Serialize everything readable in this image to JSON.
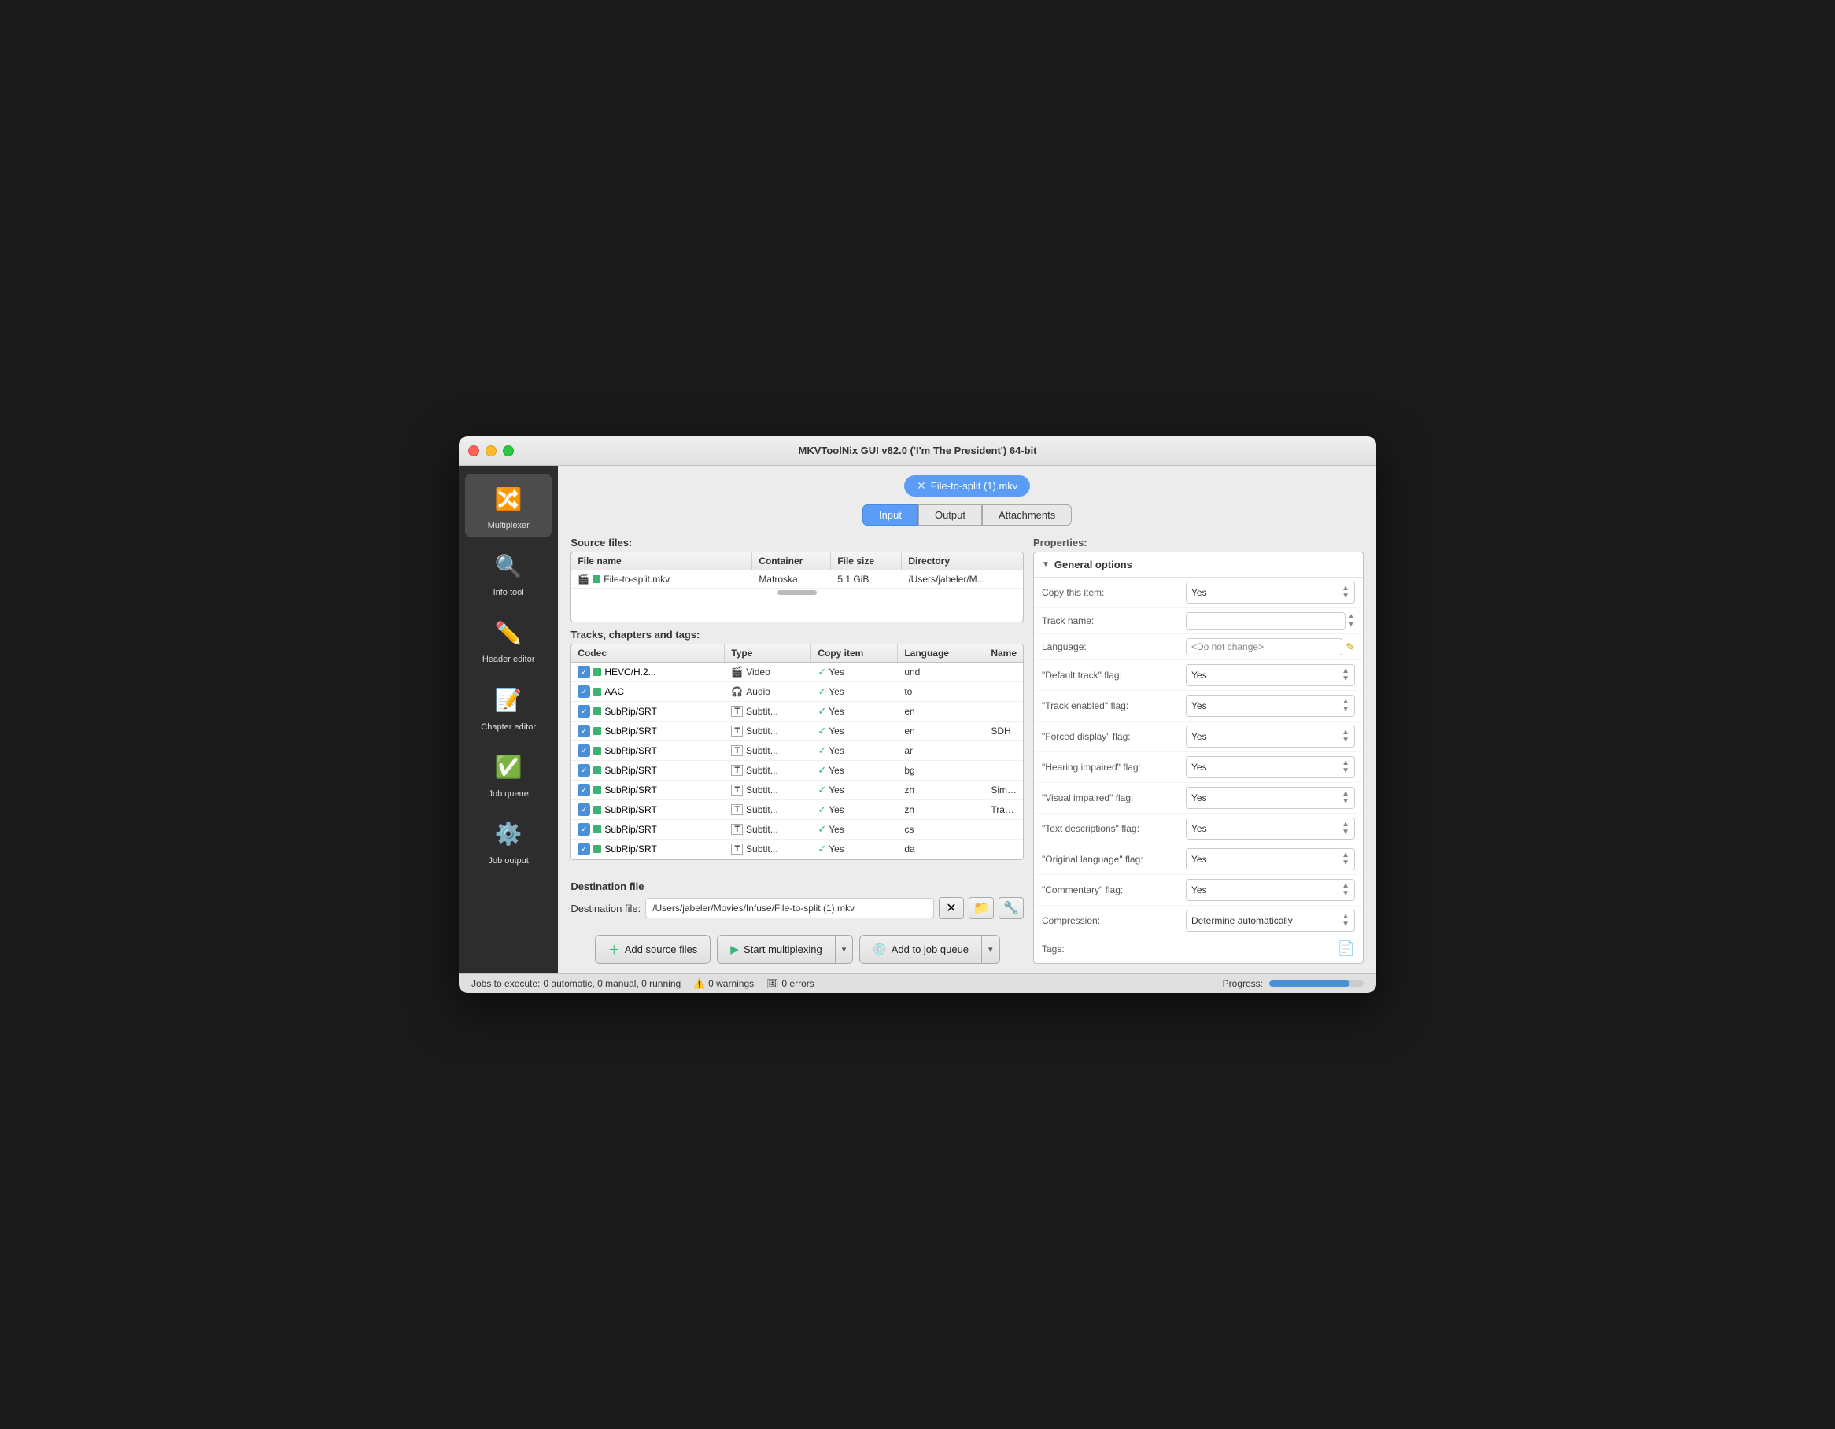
{
  "window": {
    "title": "MKVToolNix GUI v82.0 ('I'm The President') 64-bit"
  },
  "sidebar": {
    "items": [
      {
        "id": "multiplexer",
        "label": "Multiplexer",
        "icon": "🔀",
        "active": true
      },
      {
        "id": "info-tool",
        "label": "Info tool",
        "icon": "🔍"
      },
      {
        "id": "header-editor",
        "label": "Header editor",
        "icon": "✏️"
      },
      {
        "id": "chapter-editor",
        "label": "Chapter editor",
        "icon": "📝"
      },
      {
        "id": "job-queue",
        "label": "Job queue",
        "icon": "✅"
      },
      {
        "id": "job-output",
        "label": "Job output",
        "icon": "⚙️"
      }
    ]
  },
  "file_tab": {
    "name": "File-to-split (1).mkv",
    "close_icon": "✕"
  },
  "nav_tabs": {
    "items": [
      "Input",
      "Output",
      "Attachments"
    ],
    "active": "Input"
  },
  "source_files": {
    "label": "Source files:",
    "columns": [
      "File name",
      "Container",
      "File size",
      "Directory"
    ],
    "rows": [
      {
        "filename": "File-to-split.mkv",
        "container": "Matroska",
        "filesize": "5.1 GiB",
        "directory": "/Users/jabeler/M..."
      }
    ]
  },
  "tracks": {
    "label": "Tracks, chapters and tags:",
    "columns": [
      "Codec",
      "Type",
      "Copy item",
      "Language",
      "Name"
    ],
    "rows": [
      {
        "codec": "HEVC/H.2...",
        "type": "Video",
        "type_icon": "🎬",
        "copy": "Yes",
        "language": "und",
        "name": ""
      },
      {
        "codec": "AAC",
        "type": "Audio",
        "type_icon": "🎧",
        "copy": "Yes",
        "language": "to",
        "name": ""
      },
      {
        "codec": "SubRip/SRT",
        "type": "Subtit...",
        "type_icon": "T",
        "copy": "Yes",
        "language": "en",
        "name": ""
      },
      {
        "codec": "SubRip/SRT",
        "type": "Subtit...",
        "type_icon": "T",
        "copy": "Yes",
        "language": "en",
        "name": "SDH"
      },
      {
        "codec": "SubRip/SRT",
        "type": "Subtit...",
        "type_icon": "T",
        "copy": "Yes",
        "language": "ar",
        "name": ""
      },
      {
        "codec": "SubRip/SRT",
        "type": "Subtit...",
        "type_icon": "T",
        "copy": "Yes",
        "language": "bg",
        "name": ""
      },
      {
        "codec": "SubRip/SRT",
        "type": "Subtit...",
        "type_icon": "T",
        "copy": "Yes",
        "language": "zh",
        "name": "Simplifie"
      },
      {
        "codec": "SubRip/SRT",
        "type": "Subtit...",
        "type_icon": "T",
        "copy": "Yes",
        "language": "zh",
        "name": "Tradition"
      },
      {
        "codec": "SubRip/SRT",
        "type": "Subtit...",
        "type_icon": "T",
        "copy": "Yes",
        "language": "cs",
        "name": ""
      },
      {
        "codec": "SubRip/SRT",
        "type": "Subtit...",
        "type_icon": "T",
        "copy": "Yes",
        "language": "da",
        "name": ""
      }
    ]
  },
  "properties": {
    "label": "Properties:",
    "general_options_title": "General options",
    "rows": [
      {
        "label": "Copy this item:",
        "value": "Yes",
        "type": "select"
      },
      {
        "label": "Track name:",
        "value": "",
        "type": "input"
      },
      {
        "label": "Language:",
        "value": "<Do not change>",
        "type": "language"
      },
      {
        "label": "\"Default track\" flag:",
        "value": "Yes",
        "type": "select"
      },
      {
        "label": "\"Track enabled\" flag:",
        "value": "Yes",
        "type": "select"
      },
      {
        "label": "\"Forced display\" flag:",
        "value": "Yes",
        "type": "select"
      },
      {
        "label": "\"Hearing impaired\" flag:",
        "value": "Yes",
        "type": "select"
      },
      {
        "label": "\"Visual impaired\" flag:",
        "value": "Yes",
        "type": "select"
      },
      {
        "label": "\"Text descriptions\" flag:",
        "value": "Yes",
        "type": "select"
      },
      {
        "label": "\"Original language\" flag:",
        "value": "Yes",
        "type": "select"
      },
      {
        "label": "\"Commentary\" flag:",
        "value": "Yes",
        "type": "select"
      },
      {
        "label": "Compression:",
        "value": "Determine automatically",
        "type": "select"
      },
      {
        "label": "Tags:",
        "value": "",
        "type": "tags"
      }
    ]
  },
  "destination": {
    "section_label": "Destination file",
    "label": "Destination file:",
    "value": "/Users/jabeler/Movies/Infuse/File-to-split (1).mkv"
  },
  "action_buttons": {
    "add_source": "Add source files",
    "start_mux": "Start multiplexing",
    "add_queue": "Add to job queue"
  },
  "statusbar": {
    "jobs_label": "Jobs to execute:",
    "jobs_value": "0 automatic, 0 manual, 0 running",
    "warnings_label": "0 warnings",
    "errors_label": "0 errors",
    "progress_label": "Progress:",
    "progress_value": 85
  },
  "colors": {
    "accent": "#5b9cf6",
    "green": "#3cb371",
    "sidebar_bg": "#2d2d2d"
  }
}
